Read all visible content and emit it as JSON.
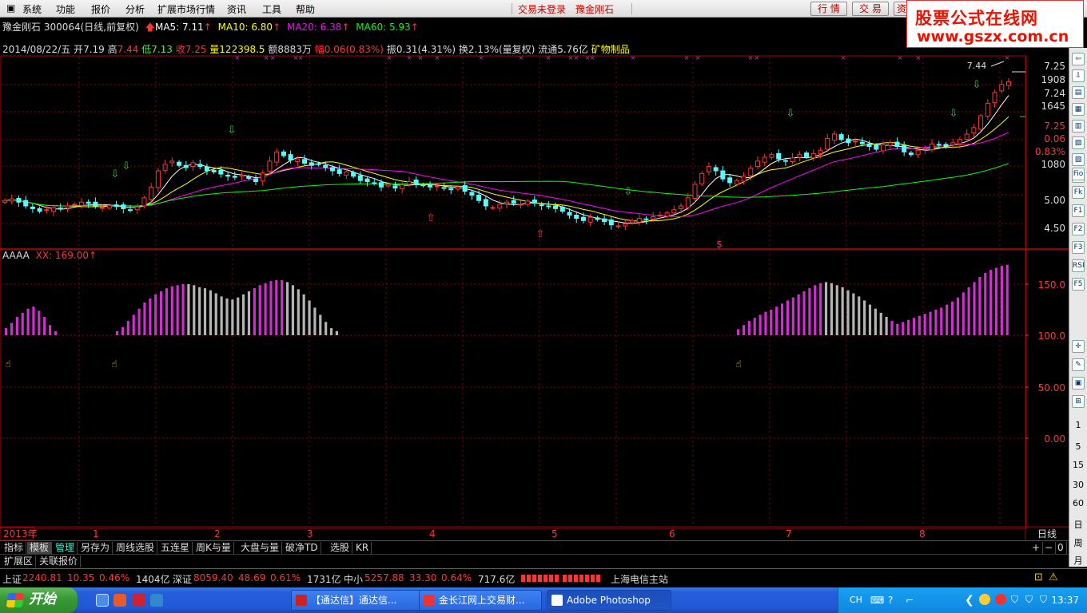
{
  "menubar": {
    "items": [
      "系统",
      "功能",
      "报价",
      "分析",
      "扩展市场行情",
      "资讯",
      "工具",
      "帮助"
    ],
    "trade_status": "交易未登录",
    "stock_name": "豫金刚石",
    "btn_quote": "行 情",
    "btn_trade": "交 易",
    "btn_third": "资"
  },
  "brand": {
    "line1": "股票公式在线网",
    "line2": "www.gszx.com.cn"
  },
  "info1": {
    "name": "豫金刚石 300064(日线,前复权)",
    "ma5": "MA5: 7.11",
    "ma10": "MA10: 6.80",
    "ma20": "MA20: 6.38",
    "ma60": "MA60: 5.93"
  },
  "info2": {
    "date": "2014/08/22/五",
    "open_label": "开",
    "open": "7.19",
    "high_label": "高",
    "high": "7.44",
    "low_label": "低",
    "low": "7.13",
    "close_label": "收",
    "close": "7.25",
    "vol": "量122398.5",
    "amount": "额8883万",
    "change": "幅0.06(0.83%)",
    "amplitude": "振0.31(4.31%)",
    "turnover": "换2.13%(量复权)",
    "float": "流通5.76亿",
    "sector": "矿物制品"
  },
  "price_axis": {
    "labels": [
      "7.25",
      "1908",
      "7.24",
      "1645",
      "7.25",
      "0.06",
      "0.83%",
      "1080",
      "5.00",
      "4.50"
    ],
    "high_mark": "7.44",
    "dollar": "$"
  },
  "indicator": {
    "title": "AAAA",
    "xx": "XX: 169.00",
    "axis": [
      "150.0",
      "100.0",
      "50.00",
      "0.00"
    ]
  },
  "time_axis": {
    "labels": [
      "2013年",
      "1",
      "2",
      "3",
      "4",
      "5",
      "6",
      "7",
      "8"
    ],
    "period": "日线"
  },
  "tabs": [
    {
      "label": "指标"
    },
    {
      "label": "模板"
    },
    {
      "label": "管理"
    },
    {
      "label": "另存为"
    },
    {
      "label": "周线选股"
    },
    {
      "label": "五连星"
    },
    {
      "label": "周K与量"
    },
    {
      "label": "大盘与量"
    },
    {
      "label": "破净TD"
    },
    {
      "label": "选股"
    },
    {
      "label": "KR"
    }
  ],
  "tabs_controls": [
    "+",
    "−",
    "0"
  ],
  "tabs2": [
    "扩展区",
    "关联报价"
  ],
  "right_toolbar": {
    "nums": [
      "1",
      "5",
      "15",
      "30",
      "60",
      "日",
      "周",
      "月"
    ],
    "icons": [
      "Fio",
      "Fk",
      "F1",
      "F2",
      "F3",
      "RSI",
      "F5"
    ]
  },
  "status": {
    "sh_label": "上证",
    "sh_val": "2240.81",
    "sh_chg": "10.35",
    "sh_pct": "0.46%",
    "sh_amt": "1404亿",
    "sz_label": "深证",
    "sz_val": "8059.40",
    "sz_chg": "48.69",
    "sz_pct": "0.61%",
    "sz_amt": "1731亿",
    "zx_label": "中小",
    "zx_val": "5257.88",
    "zx_chg": "33.30",
    "zx_pct": "0.64%",
    "zx_amt": "717.6亿",
    "server": "上海电信主站"
  },
  "taskbar": {
    "start": "开始",
    "tasks": [
      "【通达信】通达信...",
      "金长江网上交易财...",
      "Adobe Photoshop"
    ],
    "lang": "CH",
    "clock": "13:37"
  },
  "colors": {
    "up": "#ff3232",
    "down": "#54ffff",
    "ma5": "#ffffff",
    "ma10": "#ffff00",
    "ma20": "#ff00ff",
    "ma60": "#00ff00",
    "grid": "#8b0000",
    "bar_magenta": "#d22cd2",
    "bar_gray": "#b4b4b4"
  },
  "chart_data": {
    "type": "candlestick",
    "ma_last": {
      "MA5": 7.11,
      "MA10": 6.8,
      "MA20": 6.38,
      "MA60": 5.93
    },
    "close_series": [
      5.05,
      5.08,
      5.02,
      4.95,
      4.9,
      4.85,
      4.88,
      4.92,
      4.9,
      4.95,
      4.98,
      5.02,
      5.0,
      4.95,
      4.92,
      4.96,
      4.94,
      4.9,
      4.88,
      4.93,
      5.1,
      5.3,
      5.6,
      5.72,
      5.78,
      5.7,
      5.66,
      5.75,
      5.68,
      5.6,
      5.58,
      5.54,
      5.5,
      5.48,
      5.52,
      5.46,
      5.4,
      5.56,
      5.78,
      5.95,
      5.88,
      5.8,
      5.82,
      5.74,
      5.7,
      5.72,
      5.66,
      5.6,
      5.55,
      5.58,
      5.5,
      5.42,
      5.4,
      5.38,
      5.3,
      5.35,
      5.28,
      5.34,
      5.4,
      5.36,
      5.33,
      5.3,
      5.32,
      5.28,
      5.25,
      5.3,
      5.22,
      5.15,
      5.05,
      4.95,
      4.92,
      4.98,
      5.02,
      5.0,
      4.98,
      5.04,
      5.0,
      4.96,
      4.94,
      4.9,
      4.85,
      4.78,
      4.72,
      4.68,
      4.74,
      4.7,
      4.66,
      4.6,
      4.58,
      4.62,
      4.68,
      4.72,
      4.7,
      4.75,
      4.78,
      4.82,
      4.88,
      4.95,
      5.1,
      5.35,
      5.55,
      5.68,
      5.6,
      5.45,
      5.38,
      5.42,
      5.5,
      5.65,
      5.78,
      5.85,
      5.9,
      5.82,
      5.78,
      5.84,
      5.9,
      5.86,
      5.92,
      5.98,
      6.2,
      6.28,
      6.18,
      6.12,
      6.15,
      6.1,
      6.05,
      6.0,
      6.08,
      6.12,
      6.05,
      5.95,
      5.9,
      5.98,
      6.02,
      6.1,
      6.08,
      6.05,
      6.12,
      6.18,
      6.28,
      6.4,
      6.62,
      6.85,
      7.05,
      7.2,
      7.25
    ]
  }
}
